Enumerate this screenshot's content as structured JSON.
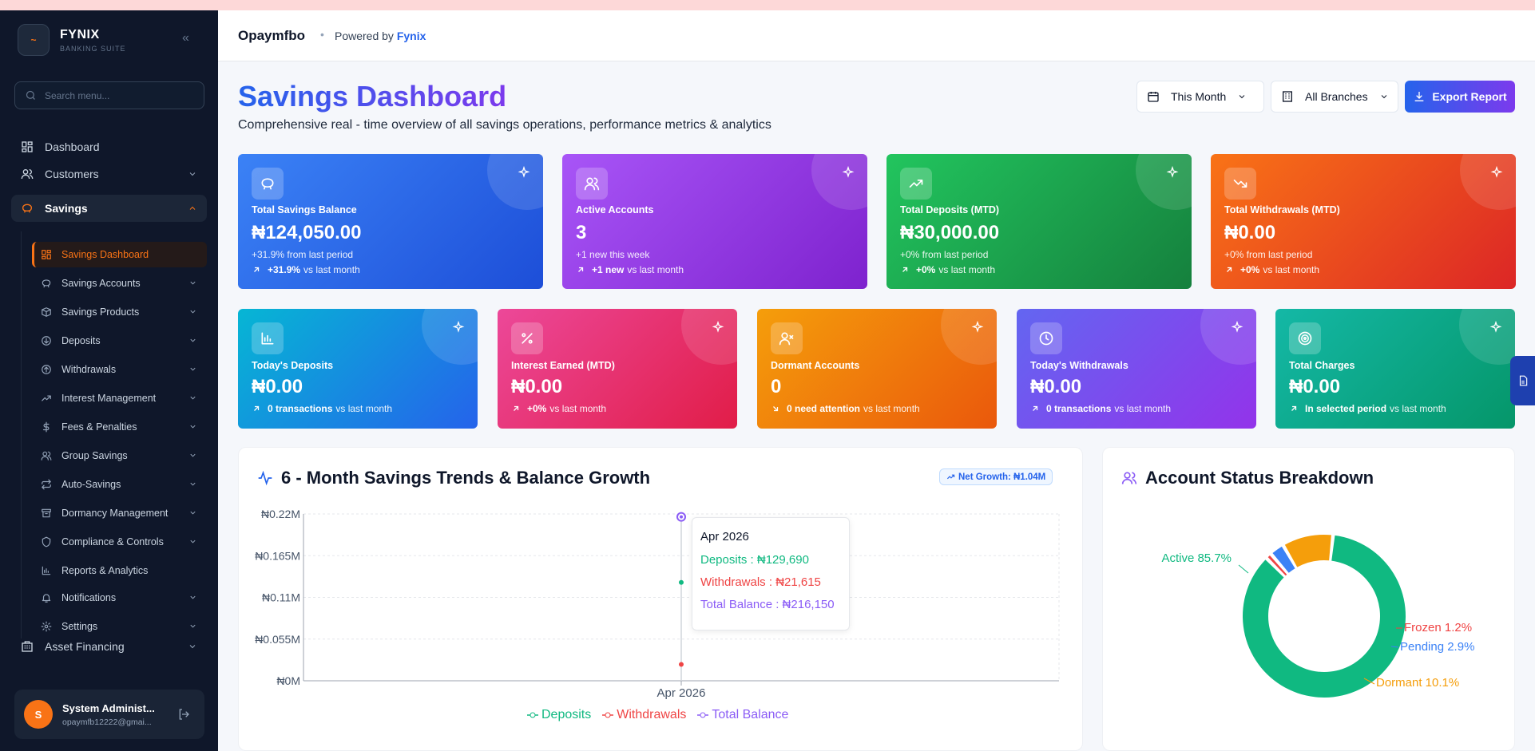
{
  "brand": {
    "name": "FYNIX",
    "subtitle": "BANKING SUITE",
    "logo_glyph": "~"
  },
  "search": {
    "placeholder": "Search menu..."
  },
  "nav": {
    "dashboard": "Dashboard",
    "customers": "Customers",
    "savings": "Savings",
    "asset_financing": "Asset Financing",
    "savings_sub": [
      {
        "label": "Savings Dashboard",
        "icon": "grid-icon"
      },
      {
        "label": "Savings Accounts",
        "icon": "piggy-bank-icon"
      },
      {
        "label": "Savings Products",
        "icon": "box-icon"
      },
      {
        "label": "Deposits",
        "icon": "arrow-down-circle-icon"
      },
      {
        "label": "Withdrawals",
        "icon": "arrow-up-circle-icon"
      },
      {
        "label": "Interest Management",
        "icon": "trending-up-icon"
      },
      {
        "label": "Fees & Penalties",
        "icon": "dollar-icon"
      },
      {
        "label": "Group Savings",
        "icon": "users-icon"
      },
      {
        "label": "Auto-Savings",
        "icon": "repeat-icon"
      },
      {
        "label": "Dormancy Management",
        "icon": "archive-icon"
      },
      {
        "label": "Compliance & Controls",
        "icon": "shield-icon"
      },
      {
        "label": "Reports & Analytics",
        "icon": "bar-chart-icon"
      },
      {
        "label": "Notifications",
        "icon": "bell-icon"
      },
      {
        "label": "Settings",
        "icon": "gear-icon"
      }
    ]
  },
  "user": {
    "initial": "S",
    "name": "System Administ...",
    "email": "opaymfb12222@gmai..."
  },
  "header": {
    "org": "Opaymfbo",
    "separator": "•",
    "powered_prefix": "Powered by",
    "powered_brand": "Fynix"
  },
  "page": {
    "title": "Savings Dashboard",
    "subtitle": "Comprehensive real - time overview of all savings operations, performance metrics & analytics",
    "period": "This Month",
    "branch": "All Branches",
    "export": "Export Report"
  },
  "cards_top": [
    {
      "label": "Total Savings Balance",
      "value": "₦124,050.00",
      "note": "+31.9% from last period",
      "trend_bold": "+31.9%",
      "trend_text": "vs last month",
      "icon": "piggy-bank-icon"
    },
    {
      "label": "Active Accounts",
      "value": "3",
      "note": "+1 new this week",
      "trend_bold": "+1 new",
      "trend_text": "vs last month",
      "icon": "users-icon"
    },
    {
      "label": "Total Deposits (MTD)",
      "value": "₦30,000.00",
      "note": "+0% from last period",
      "trend_bold": "+0%",
      "trend_text": "vs last month",
      "icon": "trending-up-icon"
    },
    {
      "label": "Total Withdrawals (MTD)",
      "value": "₦0.00",
      "note": "+0% from last period",
      "trend_bold": "+0%",
      "trend_text": "vs last month",
      "icon": "trending-down-icon"
    }
  ],
  "cards_bottom": [
    {
      "label": "Today's Deposits",
      "value": "₦0.00",
      "trend_bold": "0 transactions",
      "trend_text": "vs last month",
      "icon": "bar-chart-icon"
    },
    {
      "label": "Interest Earned (MTD)",
      "value": "₦0.00",
      "trend_bold": "+0%",
      "trend_text": "vs last month",
      "icon": "percent-icon"
    },
    {
      "label": "Dormant Accounts",
      "value": "0",
      "trend_bold": "0 need attention",
      "trend_text": "vs last month",
      "icon": "user-x-icon"
    },
    {
      "label": "Today's Withdrawals",
      "value": "₦0.00",
      "trend_bold": "0 transactions",
      "trend_text": "vs last month",
      "icon": "clock-icon"
    },
    {
      "label": "Total Charges",
      "value": "₦0.00",
      "trend_bold": "In selected period",
      "trend_text": "vs last month",
      "icon": "target-icon"
    }
  ],
  "trend_panel": {
    "title": "6 - Month Savings Trends & Balance Growth",
    "badge": "Net Growth: ₦1.04M",
    "tooltip": {
      "title": "Apr 2026",
      "deposits": "Deposits : ₦129,690",
      "withdrawals": "Withdrawals : ₦21,615",
      "balance": "Total Balance : ₦216,150"
    },
    "legend": {
      "deposits": "Deposits",
      "withdrawals": "Withdrawals",
      "balance": "Total Balance"
    }
  },
  "status_panel": {
    "title": "Account Status Breakdown"
  },
  "colors": {
    "deposits": "#10b981",
    "withdrawals": "#ef4444",
    "balance": "#8b5cf6",
    "accent": "#f97316"
  },
  "chart_data": [
    {
      "type": "line",
      "title": "6 - Month Savings Trends & Balance Growth",
      "x": [
        "Apr 2026"
      ],
      "yticks": [
        "₦0.22M",
        "₦0.165M",
        "₦0.11M",
        "₦0.055M",
        "₦0M"
      ],
      "ylim": [
        0,
        0.22
      ],
      "series": [
        {
          "name": "Deposits",
          "values": [
            129690
          ],
          "color": "#10b981"
        },
        {
          "name": "Withdrawals",
          "values": [
            21615
          ],
          "color": "#ef4444"
        },
        {
          "name": "Total Balance",
          "values": [
            216150
          ],
          "color": "#8b5cf6"
        }
      ],
      "grid": true,
      "legend": "bottom"
    },
    {
      "type": "pie",
      "title": "Account Status Breakdown",
      "slices": [
        {
          "label": "Active",
          "value": 85.7,
          "color": "#10b981",
          "text": "Active 85.7%"
        },
        {
          "label": "Frozen",
          "value": 1.2,
          "color": "#ef4444",
          "text": "Frozen 1.2%"
        },
        {
          "label": "Pending",
          "value": 2.9,
          "color": "#3b82f6",
          "text": "Pending 2.9%"
        },
        {
          "label": "Dormant",
          "value": 10.1,
          "color": "#f59e0b",
          "text": "Dormant 10.1%"
        }
      ]
    }
  ]
}
